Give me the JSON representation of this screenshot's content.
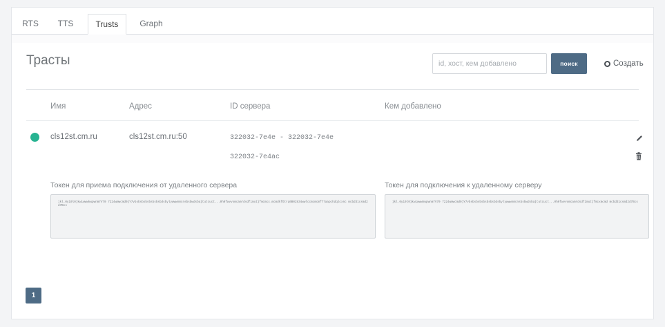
{
  "tabs": [
    {
      "label": "RTS"
    },
    {
      "label": "TTS"
    },
    {
      "label": "Trusts"
    },
    {
      "label": "Graph"
    }
  ],
  "page": {
    "title": "Трасты",
    "search_placeholder": "id, хост, кем добавлено",
    "search_button": "поиск",
    "create_label": "Создать"
  },
  "table": {
    "headers": [
      "Имя",
      "Адрес",
      "ID сервера",
      "Кем добавлено"
    ],
    "rows": [
      {
        "status": "online",
        "name": "cls12st.cm.ru",
        "address": "cls12st.cm.ru:50",
        "server_ids": [
          "322032-7e4e - 322032-7e4e",
          "322032-7e4ac"
        ],
        "added_by": ""
      }
    ]
  },
  "tokens": {
    "incoming_label": "Токен для приема подключения от удаленного сервера",
    "incoming_value": "jkl.0yi0l0jkwiwwwkwpwnm7V70 7224wmwcmd0jY7vbsbsbsbsbsbsbsbdsbylywwwnmcnsbsbwdsbajtutcuct...0h0fwvvomcamrdsdfimutjfmcmcx.mcmdkfOtrq0B02834wwlccmcmcmfT7aapchdqlcxnc mcbd31csmd2d7Bcs",
    "outgoing_label": "Токен для подключения к удаленному серверу",
    "outgoing_value": "jkl.0yi0l0jkwiwwwkwpwnm7V70 7224wmwcmd0jY7vbsbsbsbsbsbsbsbdsbylywwwnmcnsbsbwdsbajtutcuct...0h0fwvvomcamrdsdfimutjfmcxmcmd mcbd31csmd2d7Bcs"
  },
  "pagination": {
    "current": "1"
  },
  "colors": {
    "accent": "#4e6b85",
    "status_online": "#27b391"
  }
}
